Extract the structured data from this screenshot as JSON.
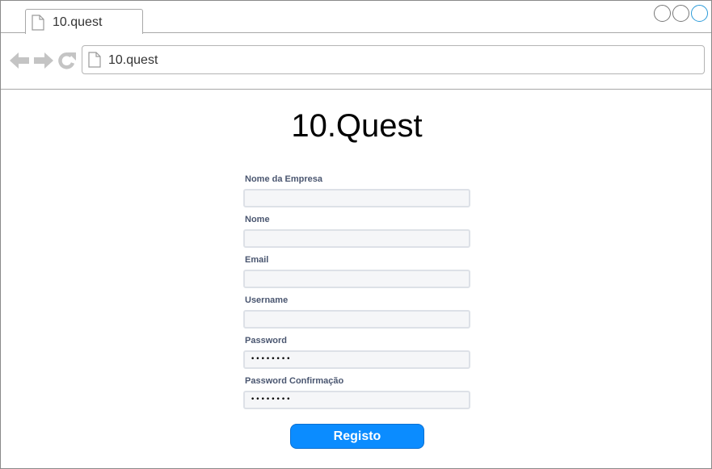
{
  "browser": {
    "tab_title": "10.quest",
    "address": "10.quest"
  },
  "page": {
    "title": "10.Quest"
  },
  "form": {
    "fields": [
      {
        "label": "Nome da Empresa",
        "value": ""
      },
      {
        "label": "Nome",
        "value": ""
      },
      {
        "label": "Email",
        "value": ""
      },
      {
        "label": "Username",
        "value": ""
      },
      {
        "label": "Password",
        "value": "••••••••"
      },
      {
        "label": "Password Confirmação",
        "value": "••••••••"
      }
    ],
    "submit_label": "Registo"
  },
  "colors": {
    "accent": "#0b8cff",
    "label": "#4a5670"
  }
}
